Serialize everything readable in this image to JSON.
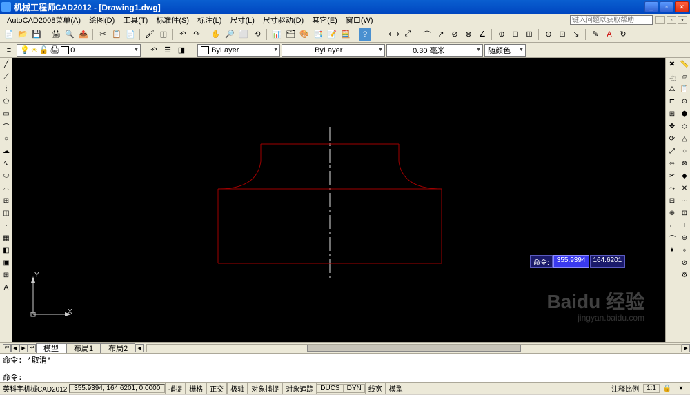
{
  "titlebar": {
    "title": "机械工程师CAD2012 - [Drawing1.dwg]"
  },
  "menubar": {
    "items": [
      "AutoCAD2008菜单(A)",
      "绘图(D)",
      "工具(T)",
      "标准件(S)",
      "标注(L)",
      "尺寸(L)",
      "尺寸驱动(D)",
      "其它(E)",
      "窗口(W)"
    ],
    "help_placeholder": "键入问题以获取帮助"
  },
  "layer_panel": {
    "layer_name": "0",
    "linetype": "ByLayer",
    "linetype2": "ByLayer",
    "lineweight": "0.30 毫米",
    "plotstyle": "随颜色"
  },
  "command_tooltip": {
    "label": "命令:",
    "x": "355.9394",
    "y": "164.6201"
  },
  "tabs": {
    "model": "模型",
    "layout1": "布局1",
    "layout2": "布局2"
  },
  "command_window": {
    "line1": "命令: *取消*",
    "prompt": "命令:"
  },
  "statusbar": {
    "app": "英科宇机械CAD2012",
    "coords": "355.9394, 164.6201, 0.0000",
    "toggles": [
      "捕捉",
      "栅格",
      "正交",
      "极轴",
      "对象捕捉",
      "对象追踪",
      "DUCS",
      "DYN",
      "线宽",
      "模型"
    ],
    "annoscale_label": "注释比例",
    "annoscale_value": "1:1"
  },
  "ucs": {
    "x": "X",
    "y": "Y"
  },
  "watermark": {
    "main": "Baidu 经验",
    "sub": "jingyan.baidu.com"
  }
}
